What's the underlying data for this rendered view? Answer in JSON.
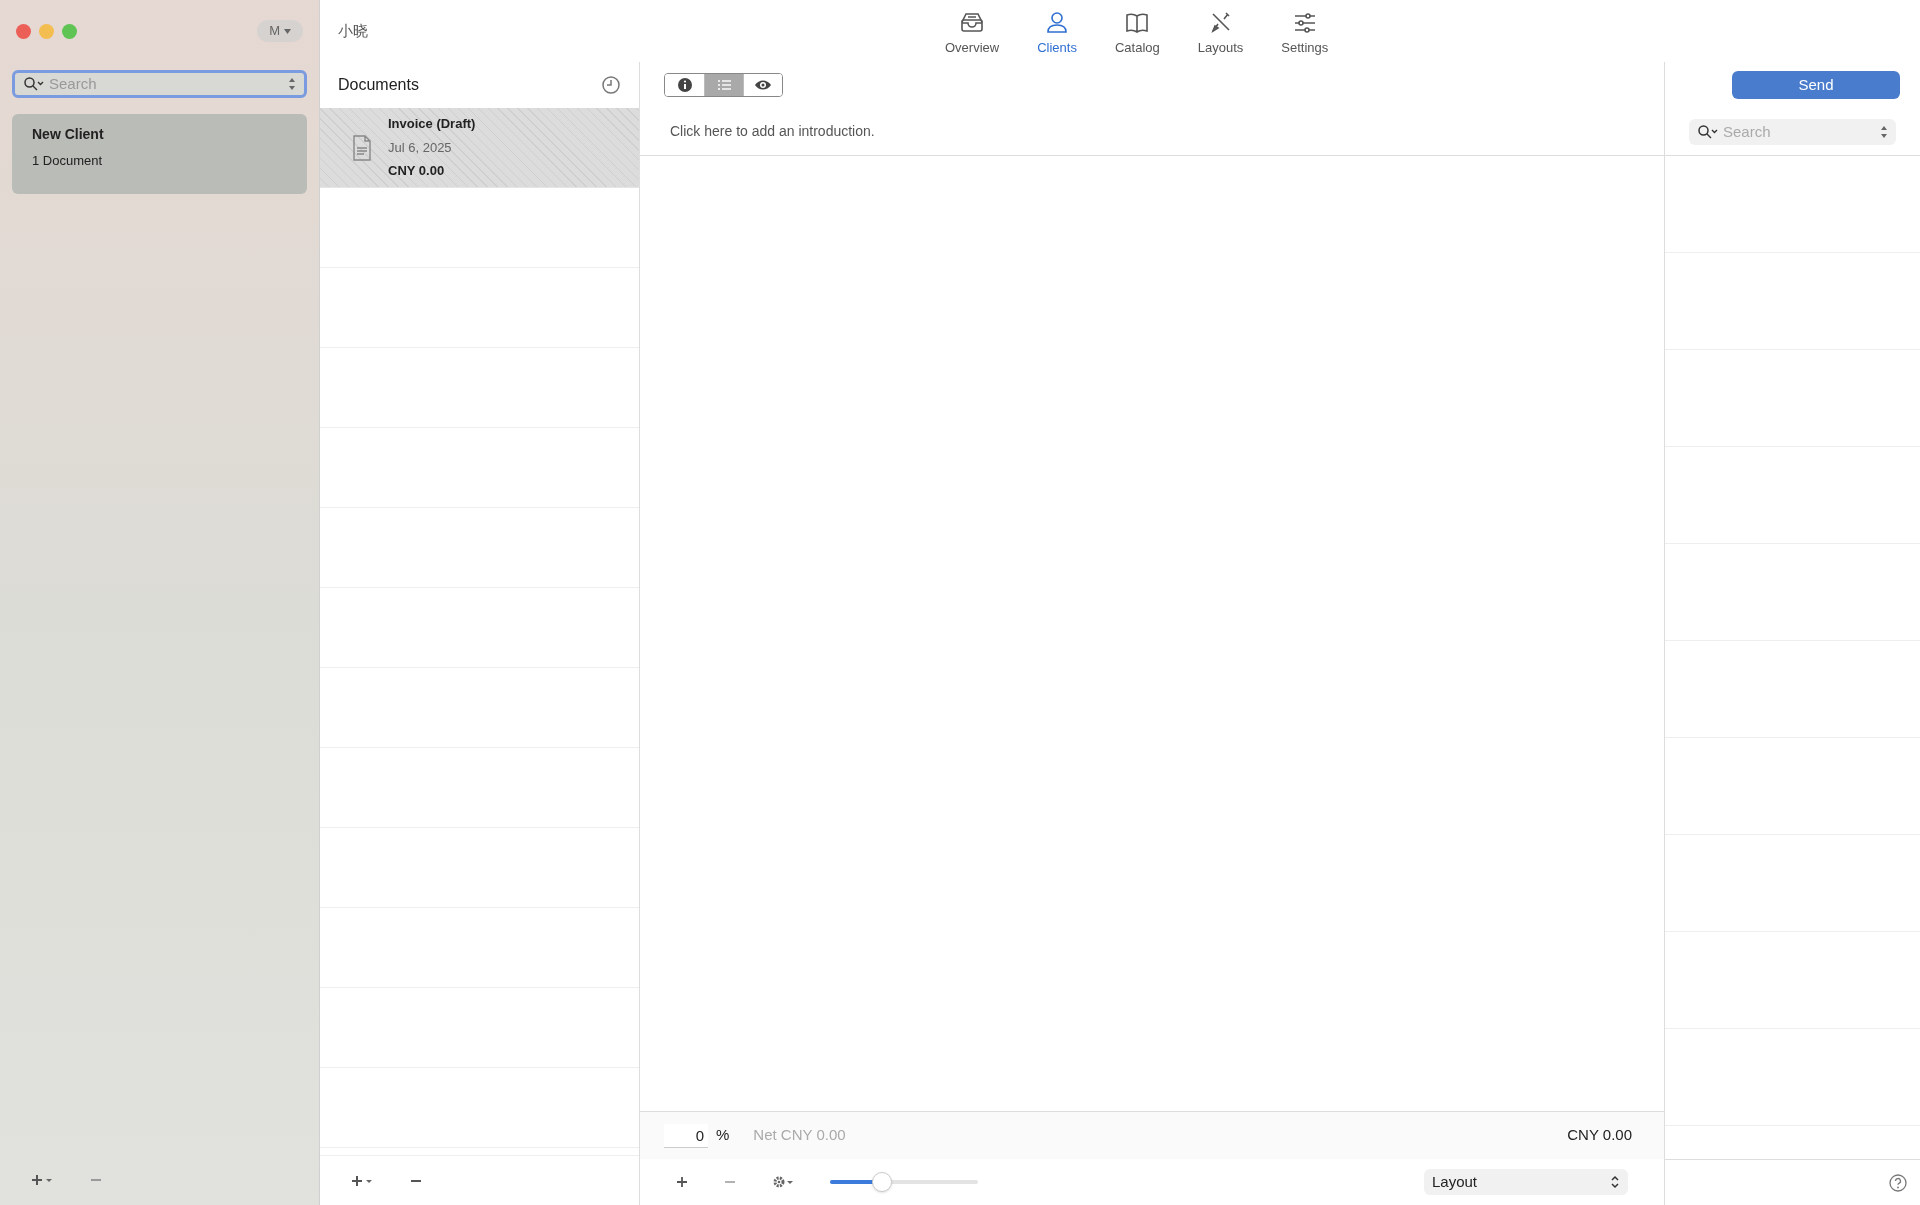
{
  "window": {
    "title": "小晓",
    "account_menu": "M"
  },
  "toolbar": {
    "tabs": [
      {
        "label": "Overview",
        "selected": false
      },
      {
        "label": "Clients",
        "selected": true
      },
      {
        "label": "Catalog",
        "selected": false
      },
      {
        "label": "Layouts",
        "selected": false
      },
      {
        "label": "Settings",
        "selected": false
      }
    ]
  },
  "sidebar": {
    "search": {
      "placeholder": "Search",
      "focused": true
    },
    "clients": [
      {
        "name": "New Client",
        "count": "1 Document",
        "selected": true
      }
    ]
  },
  "documents": {
    "title": "Documents",
    "items": [
      {
        "title": "Invoice (Draft)",
        "date": "Jul 6, 2025",
        "amount": "CNY 0.00",
        "selected": true
      }
    ]
  },
  "editor": {
    "view_modes": [
      {
        "selected": false
      },
      {
        "selected": true
      },
      {
        "selected": false
      }
    ],
    "introduction_placeholder": "Click here to add an introduction.",
    "discount": "0",
    "percent_sign": "%",
    "net": "Net CNY 0.00",
    "total": "CNY 0.00",
    "zoom": {
      "level": 0.35
    },
    "layout_select": "Layout"
  },
  "send_button": "Send",
  "catalog": {
    "search": {
      "placeholder": "Search"
    }
  }
}
